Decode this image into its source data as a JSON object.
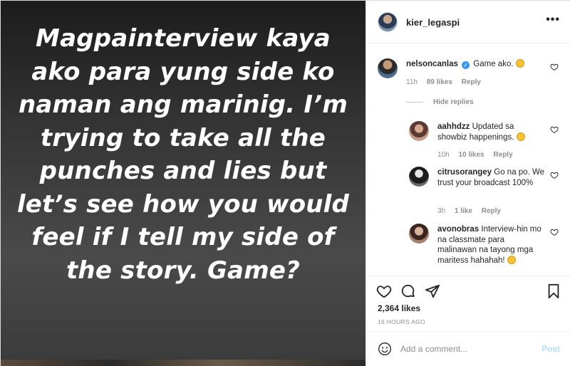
{
  "post": {
    "caption": "Magpainterview kaya ako para yung side ko naman ang marinig. I’m trying to take all the punches and lies but let’s see how you would feel if I tell my side of the story. Game?"
  },
  "header": {
    "username": "kier_legaspi",
    "more_label": "•••"
  },
  "comments": [
    {
      "username": "nelsoncanlas",
      "verified": true,
      "text": "Game ako.",
      "emoji": "clap-emoji",
      "time": "11h",
      "likes": "89 likes",
      "reply": "Reply"
    },
    {
      "username": "aahhdzz",
      "text": "Updated sa showbiz happenings.",
      "emoji": "laugh-emoji",
      "time": "10h",
      "likes": "10 likes",
      "reply": "Reply"
    },
    {
      "username": "citrusorangey",
      "text": "Go na po. We trust your broadcast 100%",
      "time": "3h",
      "likes": "1 like",
      "reply": "Reply"
    },
    {
      "username": "avonobras",
      "text": "Interview-hin mo na classmate para malinawan na tayong mga maritess hahahah!",
      "emoji": "laugh-emoji"
    }
  ],
  "hide_replies_label": "Hide replies",
  "actions": {
    "likes": "2,364 likes",
    "time": "16 HOURS AGO"
  },
  "add_comment": {
    "placeholder": "Add a comment...",
    "post_label": "Post"
  },
  "colors": {
    "accent": "#3897f0",
    "post_disabled": "#b2dffc",
    "meta_gray": "#8e8e8e"
  }
}
